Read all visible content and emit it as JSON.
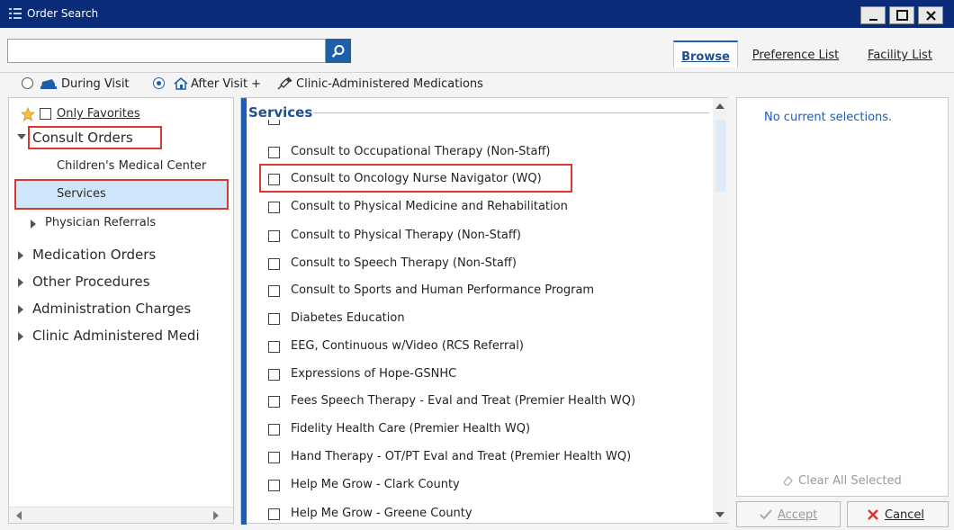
{
  "window": {
    "title": "Order Search"
  },
  "search": {
    "value": "",
    "placeholder": ""
  },
  "tabs": [
    {
      "label": "Browse",
      "active": true
    },
    {
      "label": "Preference List"
    },
    {
      "label": "Facility List"
    }
  ],
  "visit_options": {
    "during_visit": "During Visit",
    "after_visit": "After Visit +",
    "clinic_meds": "Clinic-Administered Medications"
  },
  "left_tree": {
    "only_favorites": "Only Favorites",
    "consult_orders": "Consult Orders",
    "childrens_medical_center": "Children's Medical Center",
    "services": "Services",
    "physician_referrals": "Physician Referrals",
    "medication_orders": "Medication Orders",
    "other_procedures": "Other Procedures",
    "administration_charges": "Administration Charges",
    "clinic_administered": "Clinic Administered Medi"
  },
  "services": {
    "header": "Services",
    "items": [
      "Consult to Occupational Therapy (Non-Staff)",
      "Consult to Oncology Nurse Navigator (WQ)",
      "Consult to Physical Medicine and Rehabilitation",
      "Consult to Physical Therapy (Non-Staff)",
      "Consult to Speech Therapy (Non-Staff)",
      "Consult to Sports and Human Performance Program",
      "Diabetes Education",
      "EEG, Continuous w/Video (RCS Referral)",
      "Expressions of Hope-GSNHC",
      "Fees Speech Therapy - Eval and Treat (Premier Health WQ)",
      "Fidelity Health Care (Premier Health WQ)",
      "Hand Therapy - OT/PT Eval and Treat (Premier Health WQ)",
      "Help Me Grow - Clark County",
      "Help Me Grow - Greene County"
    ]
  },
  "selections": {
    "empty_text": "No current selections.",
    "clear_all": "Clear All Selected"
  },
  "buttons": {
    "accept": "Accept",
    "cancel": "Cancel"
  },
  "colors": {
    "titlebar": "#0a2b78",
    "accent": "#1d5db3",
    "highlight_box": "#d9382f",
    "selected_row": "#cfe6fb"
  }
}
